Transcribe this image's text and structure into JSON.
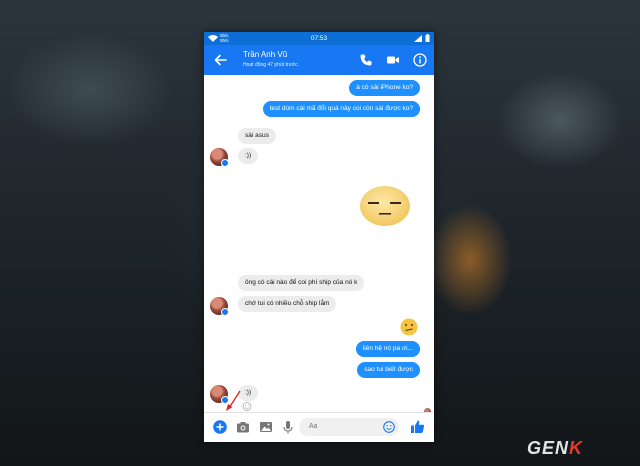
{
  "status": {
    "speed_up": "0b/s",
    "speed_down": "0b/s",
    "time": "07:53"
  },
  "header": {
    "name": "Trần Anh Vũ",
    "subtitle": "Hoạt động 47 phút trước"
  },
  "messages": {
    "m1": "à có sài iPhone ko?",
    "m2": "test dùm cái mã đổi quà này coi còn sài được ko?",
    "m3": "sài asus",
    "m4": ":))",
    "m5": "ông có cái nào để coi phí ship của nó k",
    "m6": "chớ tui có nhiều chỗ ship lắm",
    "m7": "liên hệ nó pa ơi...",
    "m8": "sao tui biết được",
    "m9": ":))",
    "m10": "=))"
  },
  "composer": {
    "placeholder": "Aa"
  },
  "watermark": {
    "gen": "GEN",
    "k": "K"
  },
  "colors": {
    "header": "#1877f2",
    "statusbar": "#0d6fd6",
    "outgoing_bubble": "#1e90ff",
    "incoming_bubble": "#ececec",
    "arrow": "#e02020"
  }
}
